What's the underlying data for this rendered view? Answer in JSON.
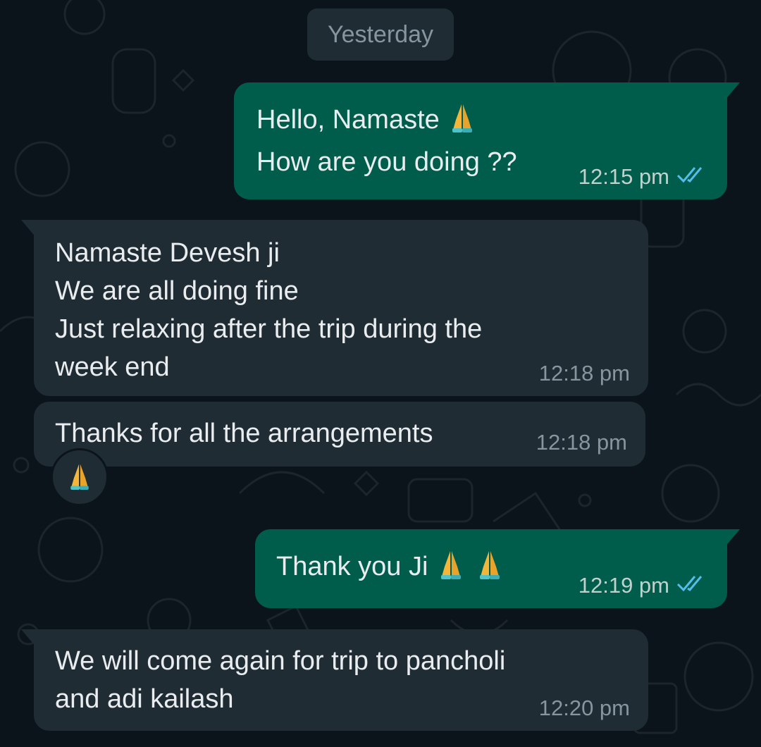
{
  "chat": {
    "date_label": "Yesterday",
    "messages": [
      {
        "direction": "outgoing",
        "lines": "Hello, Namaste",
        "line2": "How are you doing ??",
        "time": "12:15 pm",
        "status": "read",
        "emoji": [
          "folded-hands"
        ]
      },
      {
        "direction": "incoming",
        "text": "Namaste Devesh ji\nWe are all doing fine\nJust relaxing after the trip during the\nweek end",
        "time": "12:18 pm"
      },
      {
        "direction": "incoming",
        "text": "Thanks for all the arrangements",
        "time": "12:18 pm",
        "reaction": "folded-hands"
      },
      {
        "direction": "outgoing",
        "text": "Thank you Ji",
        "time": "12:19 pm",
        "status": "read",
        "emoji": [
          "folded-hands",
          "folded-hands"
        ]
      },
      {
        "direction": "incoming",
        "text": "We will come again for trip to pancholi\nand adi kailash",
        "time": "12:20 pm"
      }
    ]
  },
  "colors": {
    "background": "#0b141a",
    "outgoing_bubble": "#005c4b",
    "incoming_bubble": "#202c33",
    "read_ticks": "#53bdeb"
  }
}
